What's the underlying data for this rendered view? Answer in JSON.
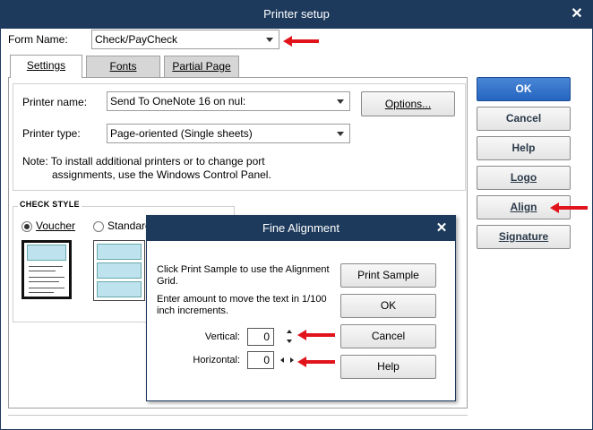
{
  "window": {
    "title": "Printer setup",
    "close_icon": "close-icon"
  },
  "form_name": {
    "label": "Form Name:",
    "value": "Check/PayCheck"
  },
  "tabs": [
    {
      "label": "Settings",
      "active": true
    },
    {
      "label": "Fonts",
      "active": false
    },
    {
      "label": "Partial Page",
      "active": false
    }
  ],
  "settings": {
    "printer_name_label": "Printer name:",
    "printer_name_value": "Send To OneNote 16 on nul:",
    "printer_type_label": "Printer type:",
    "printer_type_value": "Page-oriented (Single sheets)",
    "options_button": "Options...",
    "note_line1": "Note: To install additional printers or to change port",
    "note_line2": "assignments, use the Windows Control Panel.",
    "check_style_title": "CHECK STYLE",
    "check_styles": [
      {
        "label": "Voucher",
        "selected": true
      },
      {
        "label": "Standard",
        "selected": false
      }
    ]
  },
  "side_buttons": {
    "ok": "OK",
    "cancel": "Cancel",
    "help": "Help",
    "logo": "Logo",
    "align": "Align",
    "signature": "Signature"
  },
  "fine_alignment": {
    "title": "Fine Alignment",
    "instruction1_line1": "Click Print Sample to use the Alignment",
    "instruction1_line2": "Grid.",
    "instruction2_line1": "Enter amount to move the text in 1/100",
    "instruction2_line2": "inch increments.",
    "vertical_label": "Vertical:",
    "vertical_value": "0",
    "horizontal_label": "Horizontal:",
    "horizontal_value": "0",
    "print_sample_button": "Print Sample",
    "ok_button": "OK",
    "cancel_button": "Cancel",
    "help_button": "Help"
  },
  "colors": {
    "titlebar": "#1d3a5c",
    "primary_button": "#2565c0",
    "annotation_arrow": "#e1141b"
  }
}
